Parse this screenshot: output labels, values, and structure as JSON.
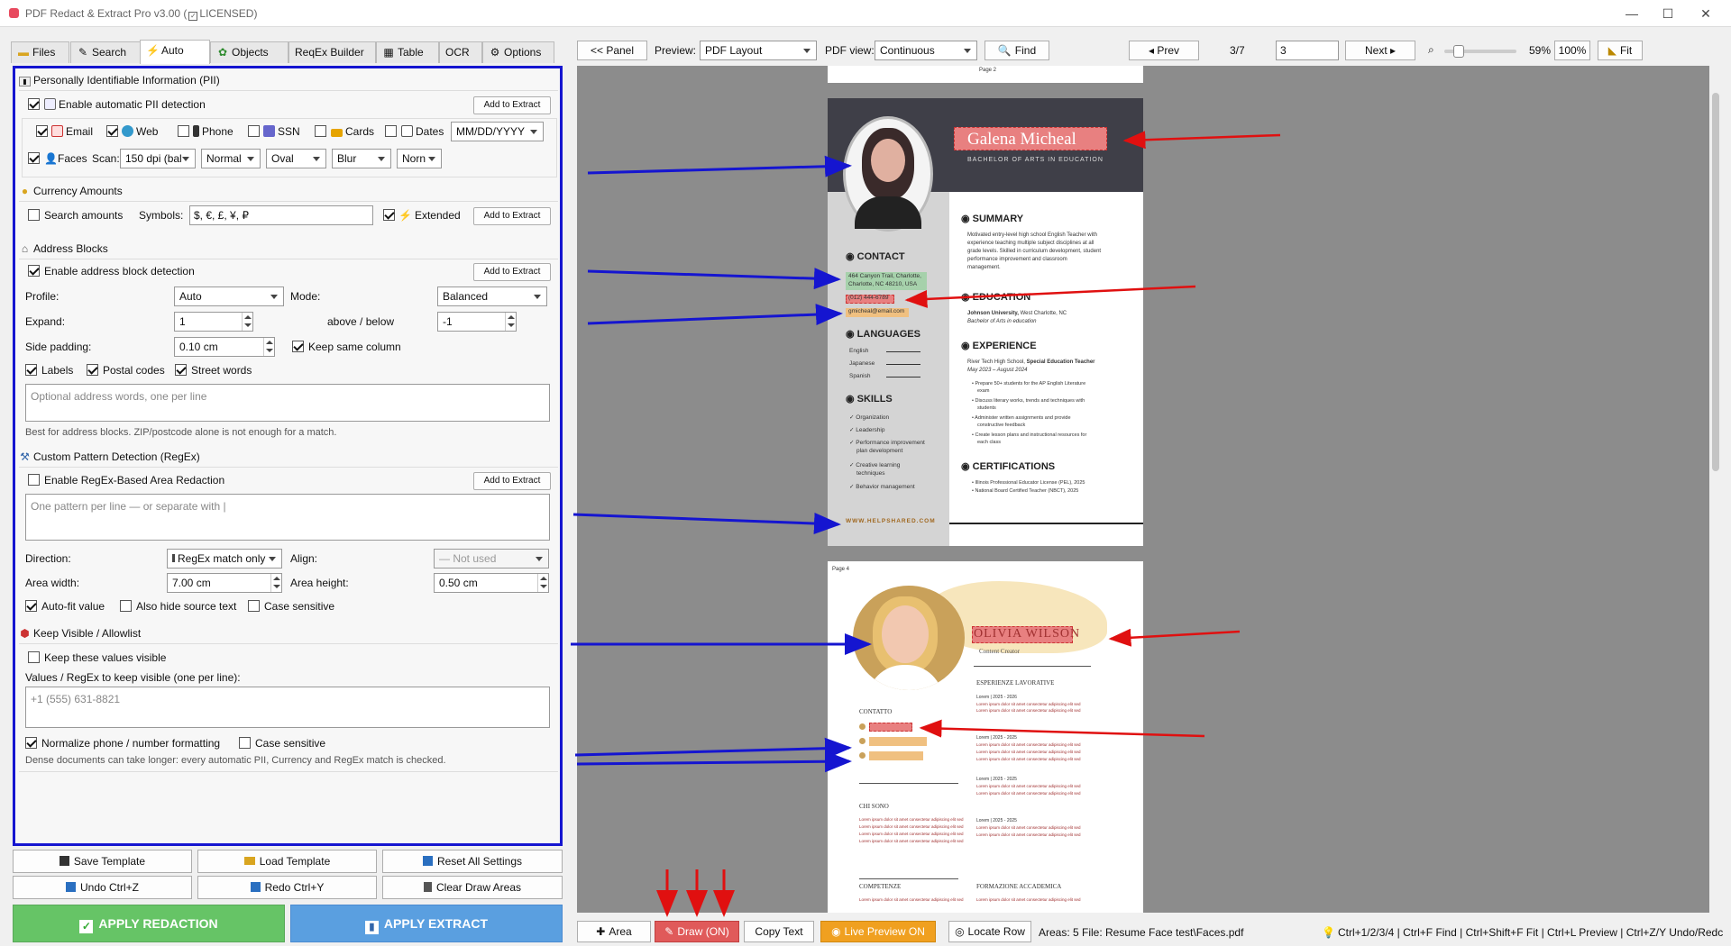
{
  "window": {
    "title": "PDF Redact & Extract Pro v3.00 (",
    "licensed": "LICENSED",
    ")": ")",
    "title_end": ")",
    "min": "—",
    "max": "☐",
    "close": "✕"
  },
  "tabs": [
    {
      "label": "Files",
      "icon": "folder-icon"
    },
    {
      "label": "Search",
      "icon": "pencil-icon"
    },
    {
      "label": "Auto",
      "icon": "lightning-icon"
    },
    {
      "label": "Objects",
      "icon": "objects-icon"
    },
    {
      "label": "ReqEx Builder",
      "icon": ""
    },
    {
      "label": "Table",
      "icon": "table-icon"
    },
    {
      "label": "OCR",
      "icon": ""
    },
    {
      "label": "Options",
      "icon": "gear-icon"
    }
  ],
  "pii": {
    "header": "Personally Identifiable Information (PII)",
    "enable_label": "Enable automatic PII detection",
    "add_btn": "Add to Extract",
    "email": "Email",
    "web": "Web",
    "phone": "Phone",
    "ssn": "SSN",
    "cards": "Cards",
    "dates": "Dates",
    "date_format": "MM/DD/YYYY",
    "faces": "Faces",
    "scan_label": "Scan:",
    "scan_value": "150 dpi (bal",
    "mode_value": "Normal",
    "shape_value": "Oval",
    "effect_value": "Blur",
    "extra_value": "Norn"
  },
  "currency": {
    "header": "Currency Amounts",
    "search_label": "Search amounts",
    "symbols_label": "Symbols:",
    "symbols_value": "$, €, £, ¥, ₽",
    "extended": "Extended",
    "add_btn": "Add to Extract"
  },
  "address": {
    "header": "Address Blocks",
    "enable_label": "Enable address block detection",
    "add_btn": "Add to Extract",
    "profile_label": "Profile:",
    "profile_value": "Auto",
    "mode_label": "Mode:",
    "mode_value": "Balanced",
    "expand_label": "Expand:",
    "expand_value": "1",
    "above_below": "above / below",
    "ab_value": "-1",
    "side_label": "Side padding:",
    "side_value": "0.10 cm",
    "keep_col": "Keep same column",
    "labels": "Labels",
    "postal": "Postal codes",
    "street": "Street words",
    "words_placeholder": "Optional address words, one per line",
    "note": "Best for address blocks. ZIP/postcode alone is not enough for a match."
  },
  "regex": {
    "header": "Custom Pattern Detection (RegEx)",
    "enable_label": "Enable RegEx-Based Area Redaction",
    "add_btn": "Add to Extract",
    "placeholder": "One pattern per line  —  or separate with |",
    "direction_label": "Direction:",
    "direction_value": "RegEx match only",
    "align_label": "Align:",
    "align_value": "— Not used",
    "width_label": "Area width:",
    "width_value": "7.00 cm",
    "height_label": "Area height:",
    "height_value": "0.50 cm",
    "autofit": "Auto-fit value",
    "hide_src": "Also hide source text",
    "case": "Case sensitive"
  },
  "allow": {
    "header": "Keep Visible / Allowlist",
    "keep_label": "Keep these values visible",
    "values_label": "Values / RegEx to keep visible (one per line):",
    "placeholder": "+1 (555) 631-8821",
    "normalize": "Normalize phone / number formatting",
    "case": "Case sensitive",
    "note": "Dense documents can take longer: every automatic PII, Currency and RegEx match is checked."
  },
  "actions": {
    "save_tpl": "Save Template",
    "load_tpl": "Load Template",
    "reset": "Reset All Settings",
    "undo": "Undo  Ctrl+Z",
    "redo": "Redo  Ctrl+Y",
    "clear": "Clear Draw Areas",
    "apply_redaction": "APPLY REDACTION",
    "apply_extract": "APPLY EXTRACT"
  },
  "toolbar": {
    "panel": "<< Panel",
    "preview_label": "Preview:",
    "preview_value": "PDF Layout",
    "pdfview_label": "PDF view:",
    "pdfview_value": "Continuous",
    "find": "Find",
    "prev": "◂ Prev",
    "page_count": "3/7",
    "page_input": "3",
    "next": "Next ▸",
    "zoom": "59%",
    "zoom100": "100%",
    "fit": "Fit"
  },
  "bottom": {
    "area": "Area",
    "draw": "Draw (ON)",
    "copy": "Copy Text",
    "live": "Live Preview ON",
    "locate": "Locate Row",
    "areas": "Areas: 5",
    "file": "File: Resume Face test\\Faces.pdf",
    "hint": "Ctrl+1/2/3/4 | Ctrl+F Find | Ctrl+Shift+F Fit | Ctrl+L Preview | Ctrl+Z/Y Undo/Redc"
  },
  "resume1": {
    "page_label": "Page 2",
    "name": "Galena Micheal",
    "degree": "BACHELOR OF ARTS IN EDUCATION",
    "contact": "CONTACT",
    "addr1": "464 Canyon Trail, Charlotte,",
    "addr2": "Charlotte, NC 48210, USA",
    "phone": "(012) 444-6789",
    "email": "gmicheal@email.com",
    "languages": "LANGUAGES",
    "lang1": "English",
    "lang2": "Japanese",
    "lang3": "Spanish",
    "skills": "SKILLS",
    "skill1": "Organization",
    "skill2": "Leadership",
    "skill3": "Performance improvement",
    "skill3b": "plan development",
    "skill4": "Creative learning",
    "skill4b": "techniques",
    "skill5": "Behavior management",
    "website": "WWW.HELPSHARED.COM",
    "summary": "SUMMARY",
    "sum1": "Motivated entry-level high school English Teacher with",
    "sum2": "experience teaching multiple subject disciplines at all",
    "sum3": "grade levels. Skilled in curriculum development, student",
    "sum4": "performance improvement and classroom",
    "sum5": "management.",
    "education": "EDUCATION",
    "edu1a": "Johnson University,",
    "edu1b": " West Charlotte, NC",
    "edu2": "Bachelor of Arts in education",
    "experience": "EXPERIENCE",
    "exp1a": "River Tech High School,",
    "exp1b": " Special Education Teacher",
    "exp2": "May 2023 – August 2024",
    "b1": "Prepare 50+ students for the AP English Literature",
    "b1b": "exam",
    "b2": "Discuss literary works, trends and techniques with",
    "b2b": "students",
    "b3": "Administer written assignments and provide",
    "b3b": "constructive feedback",
    "b4": "Create lesson plans and instructional resources for",
    "b4b": "each class",
    "certs": "CERTIFICATIONS",
    "c1": "Illinois Professional Educator License (PEL), 2025",
    "c2": "National Board Certified Teacher (NBCT), 2025"
  },
  "resume2": {
    "page_label": "Page 4",
    "name": "OLIVIA WILSON",
    "role": "Content Creator",
    "exp_head": "ESPERIENZE LAVORATIVE",
    "contact": "CONTATTO",
    "about": "CHI SONO",
    "skills": "COMPETENZE",
    "education": "FORMAZIONE ACCADEMICA",
    "job1": "Lorem | 2025 - 2026",
    "job2": "Lorem | 2025 - 2025",
    "job3": "Lorem | 2025 - 2025",
    "edu1": "Lorem | 2025 - 2025",
    "lorem": "Lorem ipsum dolor sit amet consectetur adipiscing elit sed"
  },
  "colors": {
    "accent_blue": "#1515d0",
    "green_btn": "#66c466",
    "blue_btn": "#5a9fe0",
    "draw_red": "#e05a5a",
    "live_orange": "#f0a020",
    "redact_red": "#e88080",
    "redact_green": "#9ad0a0",
    "redact_orange": "#f0c080"
  }
}
